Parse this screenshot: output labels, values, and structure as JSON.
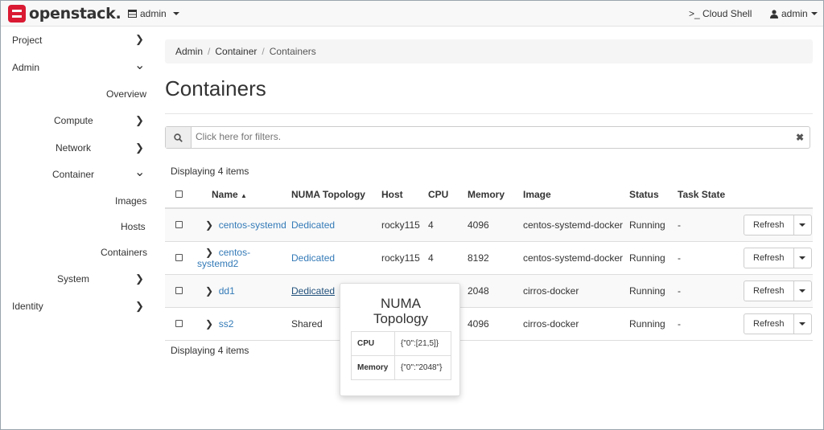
{
  "header": {
    "logo_text": "openstack.",
    "project": "admin",
    "cloud_shell": ">_ Cloud Shell",
    "user": "admin",
    "icons": {
      "project": "table-icon",
      "user": "user-icon"
    },
    "brand_color": "#da1a32"
  },
  "sidebar": {
    "project": "Project",
    "admin": "Admin",
    "overview": "Overview",
    "compute": "Compute",
    "network": "Network",
    "container": "Container",
    "images": "Images",
    "hosts": "Hosts",
    "containers": "Containers",
    "system": "System",
    "identity": "Identity",
    "chev_right": "❯",
    "chev_down": "⌄"
  },
  "breadcrumb": {
    "admin": "Admin",
    "container": "Container",
    "current": "Containers"
  },
  "page_title": "Containers",
  "filter": {
    "placeholder": "Click here for filters.",
    "clear": "✖",
    "icon": "search-icon"
  },
  "table": {
    "count_top": "Displaying 4 items",
    "count_bottom": "Displaying 4 items",
    "columns": [
      "Name",
      "NUMA Topology",
      "Host",
      "CPU",
      "Memory",
      "Image",
      "Status",
      "Task State"
    ],
    "sort_indicator": "▲",
    "rows": [
      {
        "name": "centos-systemd",
        "numa": "Dedicated",
        "host": "rocky115",
        "cpu": "4",
        "memory": "4096",
        "image": "centos-systemd-docker",
        "status": "Running",
        "task": "-",
        "action": "Refresh"
      },
      {
        "name": "centos-systemd2",
        "numa": "Dedicated",
        "host": "rocky115",
        "cpu": "4",
        "memory": "8192",
        "image": "centos-systemd-docker",
        "status": "Running",
        "task": "-",
        "action": "Refresh"
      },
      {
        "name": "dd1",
        "numa": "Dedicated",
        "host": "",
        "cpu": "",
        "memory": "2048",
        "image": "cirros-docker",
        "status": "Running",
        "task": "-",
        "action": "Refresh"
      },
      {
        "name": "ss2",
        "numa": "Shared",
        "host": "",
        "cpu": "",
        "memory": "4096",
        "image": "cirros-docker",
        "status": "Running",
        "task": "-",
        "action": "Refresh"
      }
    ]
  },
  "popover": {
    "title_line1": "NUMA",
    "title_line2": "Topology",
    "rows": [
      {
        "key": "CPU",
        "value": "{\"0\":[21,5]}"
      },
      {
        "key": "Memory",
        "value": "{\"0\":\"2048\"}"
      }
    ]
  }
}
